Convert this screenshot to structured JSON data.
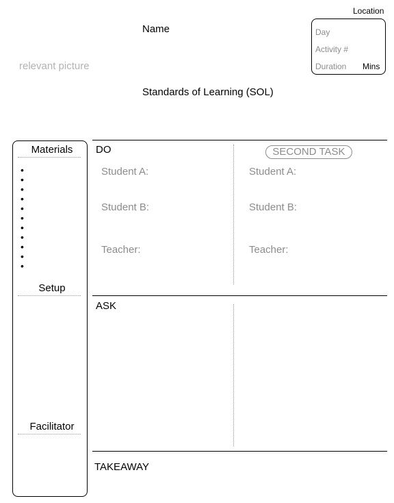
{
  "header": {
    "location": "Location",
    "name": "Name",
    "picture_placeholder": "relevant picture",
    "standards": "Standards of Learning (SOL)"
  },
  "info_box": {
    "day": "Day",
    "activity": "Activity #",
    "duration": "Duration",
    "mins": "Mins"
  },
  "sidebar": {
    "materials": "Materials",
    "bullets": [
      "•",
      "•",
      "•",
      "•",
      "•",
      "•",
      "•",
      "•",
      "•",
      "•",
      "•"
    ],
    "setup": "Setup",
    "facilitator": "Facilitator"
  },
  "do_section": {
    "title": "DO",
    "second_task": "SECOND TASK",
    "left": {
      "student_a": "Student A:",
      "student_b": "Student B:",
      "teacher": "Teacher:"
    },
    "right": {
      "student_a": "Student A:",
      "student_b": "Student B:",
      "teacher": "Teacher:"
    }
  },
  "ask_section": {
    "title": "ASK"
  },
  "takeaway_section": {
    "title": "TAKEAWAY"
  }
}
